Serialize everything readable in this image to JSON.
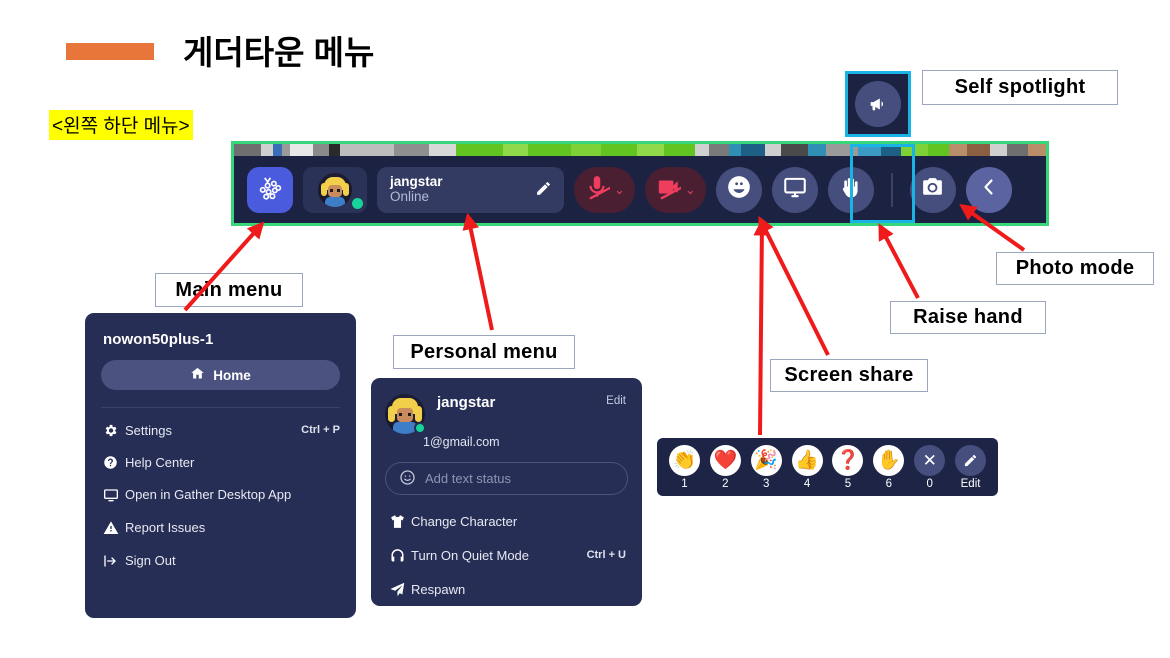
{
  "header": {
    "title": "게더타운 메뉴",
    "bar_color": "#e8753a",
    "subtitle_tag": "<왼쪽 하단 메뉴>",
    "subtitle_highlight": "#ffff00"
  },
  "callouts": [
    {
      "id": "self-spotlight",
      "label": "Self spotlight"
    },
    {
      "id": "photo-mode",
      "label": "Photo mode"
    },
    {
      "id": "raise-hand",
      "label": "Raise hand"
    },
    {
      "id": "screen-share",
      "label": "Screen share"
    },
    {
      "id": "main-menu",
      "label": "Main menu"
    },
    {
      "id": "personal-menu",
      "label": "Personal menu"
    }
  ],
  "toolbar": {
    "border_color": "#37d67a",
    "background": "#1c2342",
    "main_menu_icon": "dots-grid-icon",
    "avatar_status": "online",
    "user": {
      "name": "jangstar",
      "status": "Online"
    },
    "edit_name_icon": "pencil-icon",
    "mic": {
      "icon": "microphone-muted-icon",
      "state": "muted",
      "chevron": "⌄"
    },
    "camera": {
      "icon": "camera-muted-icon",
      "state": "muted",
      "chevron": "⌄"
    },
    "emoji_button_icon": "smiley-icon",
    "screenshare_button_icon": "monitor-icon",
    "raisehand_button_icon": "raised-hand-icon",
    "photo_button_icon": "camera-photo-icon",
    "collapse_button_icon": "chevron-left-icon"
  },
  "spotlight": {
    "icon": "megaphone-icon",
    "highlight_color": "#19b3e6"
  },
  "main_menu_panel": {
    "title": "nowon50plus-1",
    "home": {
      "label": "Home",
      "icon": "home-icon"
    },
    "items": [
      {
        "label": "Settings",
        "icon": "gear-icon",
        "shortcut": "Ctrl + P"
      },
      {
        "label": "Help Center",
        "icon": "question-circle-icon",
        "shortcut": ""
      },
      {
        "label": "Open in Gather Desktop App",
        "icon": "monitor-icon",
        "shortcut": ""
      },
      {
        "label": "Report Issues",
        "icon": "warning-triangle-icon",
        "shortcut": ""
      },
      {
        "label": "Sign Out",
        "icon": "sign-out-icon",
        "shortcut": ""
      }
    ]
  },
  "personal_menu_panel": {
    "name": "jangstar",
    "email": "1@gmail.com",
    "edit_label": "Edit",
    "status_placeholder": "Add text status",
    "status_icon": "smiley-icon",
    "items": [
      {
        "label": "Change Character",
        "icon": "shirt-icon",
        "shortcut": ""
      },
      {
        "label": "Turn On Quiet Mode",
        "icon": "headphones-icon",
        "shortcut": "Ctrl + U"
      },
      {
        "label": "Respawn",
        "icon": "paper-plane-icon",
        "shortcut": ""
      }
    ]
  },
  "emoji_bar": {
    "items": [
      {
        "glyph": "👏",
        "label": "1",
        "icon": "clapping-hands-emoji"
      },
      {
        "glyph": "❤️",
        "label": "2",
        "icon": "heart-emoji"
      },
      {
        "glyph": "🎉",
        "label": "3",
        "icon": "party-popper-emoji"
      },
      {
        "glyph": "👍",
        "label": "4",
        "icon": "thumbs-up-emoji"
      },
      {
        "glyph": "❓",
        "label": "5",
        "icon": "question-mark-emoji"
      },
      {
        "glyph": "✋",
        "label": "6",
        "icon": "raised-hand-emoji"
      },
      {
        "glyph": "✕",
        "label": "0",
        "icon": "close-icon"
      },
      {
        "glyph": "✎",
        "label": "Edit",
        "icon": "pencil-icon"
      }
    ]
  }
}
